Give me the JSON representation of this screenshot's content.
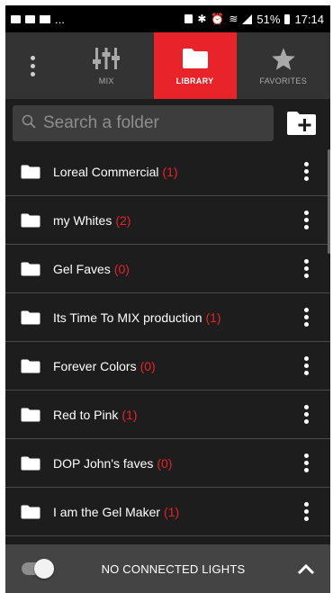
{
  "status_bar": {
    "left_text": "...",
    "battery": "51%",
    "time": "17:14"
  },
  "tabs": [
    {
      "label": "MIX",
      "icon": "sliders-icon",
      "active": false
    },
    {
      "label": "LIBRARY",
      "icon": "folder-icon",
      "active": true
    },
    {
      "label": "FAVORITES",
      "icon": "star-icon",
      "active": false
    }
  ],
  "search": {
    "placeholder": "Search a folder",
    "value": ""
  },
  "folders": [
    {
      "name": "Loreal Commercial",
      "count": "(1)"
    },
    {
      "name": "my Whites",
      "count": "(2)"
    },
    {
      "name": "Gel Faves",
      "count": "(0)"
    },
    {
      "name": "Its Time To MIX production",
      "count": "(1)"
    },
    {
      "name": "Forever Colors",
      "count": "(0)"
    },
    {
      "name": "Red to Pink",
      "count": "(1)"
    },
    {
      "name": "DOP John's faves",
      "count": "(0)"
    },
    {
      "name": "I am the Gel Maker",
      "count": "(1)"
    }
  ],
  "bottom_bar": {
    "label": "NO CONNECTED LIGHTS",
    "toggle_on": true
  },
  "colors": {
    "accent": "#e8232a",
    "background": "#1d1d1d",
    "tab_bar": "#333333"
  }
}
